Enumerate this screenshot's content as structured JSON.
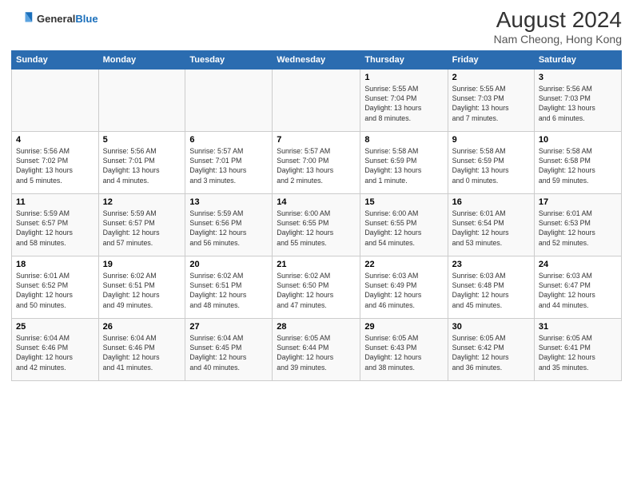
{
  "logo": {
    "line1": "General",
    "line2": "Blue"
  },
  "title": "August 2024",
  "subtitle": "Nam Cheong, Hong Kong",
  "weekdays": [
    "Sunday",
    "Monday",
    "Tuesday",
    "Wednesday",
    "Thursday",
    "Friday",
    "Saturday"
  ],
  "weeks": [
    [
      {
        "day": "",
        "info": ""
      },
      {
        "day": "",
        "info": ""
      },
      {
        "day": "",
        "info": ""
      },
      {
        "day": "",
        "info": ""
      },
      {
        "day": "1",
        "info": "Sunrise: 5:55 AM\nSunset: 7:04 PM\nDaylight: 13 hours\nand 8 minutes."
      },
      {
        "day": "2",
        "info": "Sunrise: 5:55 AM\nSunset: 7:03 PM\nDaylight: 13 hours\nand 7 minutes."
      },
      {
        "day": "3",
        "info": "Sunrise: 5:56 AM\nSunset: 7:03 PM\nDaylight: 13 hours\nand 6 minutes."
      }
    ],
    [
      {
        "day": "4",
        "info": "Sunrise: 5:56 AM\nSunset: 7:02 PM\nDaylight: 13 hours\nand 5 minutes."
      },
      {
        "day": "5",
        "info": "Sunrise: 5:56 AM\nSunset: 7:01 PM\nDaylight: 13 hours\nand 4 minutes."
      },
      {
        "day": "6",
        "info": "Sunrise: 5:57 AM\nSunset: 7:01 PM\nDaylight: 13 hours\nand 3 minutes."
      },
      {
        "day": "7",
        "info": "Sunrise: 5:57 AM\nSunset: 7:00 PM\nDaylight: 13 hours\nand 2 minutes."
      },
      {
        "day": "8",
        "info": "Sunrise: 5:58 AM\nSunset: 6:59 PM\nDaylight: 13 hours\nand 1 minute."
      },
      {
        "day": "9",
        "info": "Sunrise: 5:58 AM\nSunset: 6:59 PM\nDaylight: 13 hours\nand 0 minutes."
      },
      {
        "day": "10",
        "info": "Sunrise: 5:58 AM\nSunset: 6:58 PM\nDaylight: 12 hours\nand 59 minutes."
      }
    ],
    [
      {
        "day": "11",
        "info": "Sunrise: 5:59 AM\nSunset: 6:57 PM\nDaylight: 12 hours\nand 58 minutes."
      },
      {
        "day": "12",
        "info": "Sunrise: 5:59 AM\nSunset: 6:57 PM\nDaylight: 12 hours\nand 57 minutes."
      },
      {
        "day": "13",
        "info": "Sunrise: 5:59 AM\nSunset: 6:56 PM\nDaylight: 12 hours\nand 56 minutes."
      },
      {
        "day": "14",
        "info": "Sunrise: 6:00 AM\nSunset: 6:55 PM\nDaylight: 12 hours\nand 55 minutes."
      },
      {
        "day": "15",
        "info": "Sunrise: 6:00 AM\nSunset: 6:55 PM\nDaylight: 12 hours\nand 54 minutes."
      },
      {
        "day": "16",
        "info": "Sunrise: 6:01 AM\nSunset: 6:54 PM\nDaylight: 12 hours\nand 53 minutes."
      },
      {
        "day": "17",
        "info": "Sunrise: 6:01 AM\nSunset: 6:53 PM\nDaylight: 12 hours\nand 52 minutes."
      }
    ],
    [
      {
        "day": "18",
        "info": "Sunrise: 6:01 AM\nSunset: 6:52 PM\nDaylight: 12 hours\nand 50 minutes."
      },
      {
        "day": "19",
        "info": "Sunrise: 6:02 AM\nSunset: 6:51 PM\nDaylight: 12 hours\nand 49 minutes."
      },
      {
        "day": "20",
        "info": "Sunrise: 6:02 AM\nSunset: 6:51 PM\nDaylight: 12 hours\nand 48 minutes."
      },
      {
        "day": "21",
        "info": "Sunrise: 6:02 AM\nSunset: 6:50 PM\nDaylight: 12 hours\nand 47 minutes."
      },
      {
        "day": "22",
        "info": "Sunrise: 6:03 AM\nSunset: 6:49 PM\nDaylight: 12 hours\nand 46 minutes."
      },
      {
        "day": "23",
        "info": "Sunrise: 6:03 AM\nSunset: 6:48 PM\nDaylight: 12 hours\nand 45 minutes."
      },
      {
        "day": "24",
        "info": "Sunrise: 6:03 AM\nSunset: 6:47 PM\nDaylight: 12 hours\nand 44 minutes."
      }
    ],
    [
      {
        "day": "25",
        "info": "Sunrise: 6:04 AM\nSunset: 6:46 PM\nDaylight: 12 hours\nand 42 minutes."
      },
      {
        "day": "26",
        "info": "Sunrise: 6:04 AM\nSunset: 6:46 PM\nDaylight: 12 hours\nand 41 minutes."
      },
      {
        "day": "27",
        "info": "Sunrise: 6:04 AM\nSunset: 6:45 PM\nDaylight: 12 hours\nand 40 minutes."
      },
      {
        "day": "28",
        "info": "Sunrise: 6:05 AM\nSunset: 6:44 PM\nDaylight: 12 hours\nand 39 minutes."
      },
      {
        "day": "29",
        "info": "Sunrise: 6:05 AM\nSunset: 6:43 PM\nDaylight: 12 hours\nand 38 minutes."
      },
      {
        "day": "30",
        "info": "Sunrise: 6:05 AM\nSunset: 6:42 PM\nDaylight: 12 hours\nand 36 minutes."
      },
      {
        "day": "31",
        "info": "Sunrise: 6:05 AM\nSunset: 6:41 PM\nDaylight: 12 hours\nand 35 minutes."
      }
    ]
  ]
}
